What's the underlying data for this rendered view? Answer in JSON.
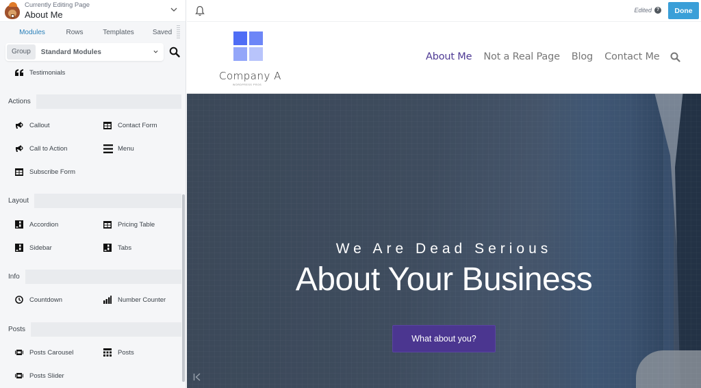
{
  "sidebar": {
    "header": {
      "subtitle": "Currently Editing Page",
      "title": "About Me"
    },
    "tabs": [
      {
        "label": "Modules",
        "active": true
      },
      {
        "label": "Rows",
        "active": false
      },
      {
        "label": "Templates",
        "active": false
      },
      {
        "label": "Saved",
        "active": false
      }
    ],
    "group": {
      "label": "Group",
      "value": "Standard Modules"
    },
    "top_modules": [
      {
        "label": "Testimonials",
        "icon": "quote-icon"
      }
    ],
    "sections": [
      {
        "title": "Actions",
        "modules": [
          {
            "label": "Callout",
            "icon": "megaphone-icon"
          },
          {
            "label": "Contact Form",
            "icon": "table-icon"
          },
          {
            "label": "Call to Action",
            "icon": "megaphone-icon"
          },
          {
            "label": "Menu",
            "icon": "menu-icon"
          },
          {
            "label": "Subscribe Form",
            "icon": "table-icon"
          }
        ]
      },
      {
        "title": "Layout",
        "modules": [
          {
            "label": "Accordion",
            "icon": "layout-icon"
          },
          {
            "label": "Pricing Table",
            "icon": "table-icon"
          },
          {
            "label": "Sidebar",
            "icon": "layout-icon"
          },
          {
            "label": "Tabs",
            "icon": "layout-icon"
          }
        ]
      },
      {
        "title": "Info",
        "modules": [
          {
            "label": "Countdown",
            "icon": "clock-icon"
          },
          {
            "label": "Number Counter",
            "icon": "bar-chart-icon"
          }
        ]
      },
      {
        "title": "Posts",
        "modules": [
          {
            "label": "Posts Carousel",
            "icon": "carousel-icon"
          },
          {
            "label": "Posts",
            "icon": "posts-grid-icon"
          },
          {
            "label": "Posts Slider",
            "icon": "carousel-icon"
          }
        ]
      }
    ]
  },
  "topbar": {
    "status": "Edited",
    "done_label": "Done"
  },
  "site": {
    "logo": {
      "name": "Company A",
      "tagline": "WORDPRESS PROS",
      "colors": [
        "#4f6df5",
        "#6d86f7",
        "#93a6f9",
        "#b8c4fb"
      ]
    },
    "nav": [
      {
        "label": "About Me",
        "active": true
      },
      {
        "label": "Not a Real Page",
        "active": false
      },
      {
        "label": "Blog",
        "active": false
      },
      {
        "label": "Contact Me",
        "active": false
      }
    ],
    "hero": {
      "subtitle": "We Are Dead Serious",
      "title": "About Your Business",
      "button_label": "What about you?"
    }
  },
  "colors": {
    "accent_blue": "#3a9fd8",
    "tab_active": "#2a80b9",
    "nav_active": "#4e3a94",
    "hero_button": "#4b3690"
  }
}
